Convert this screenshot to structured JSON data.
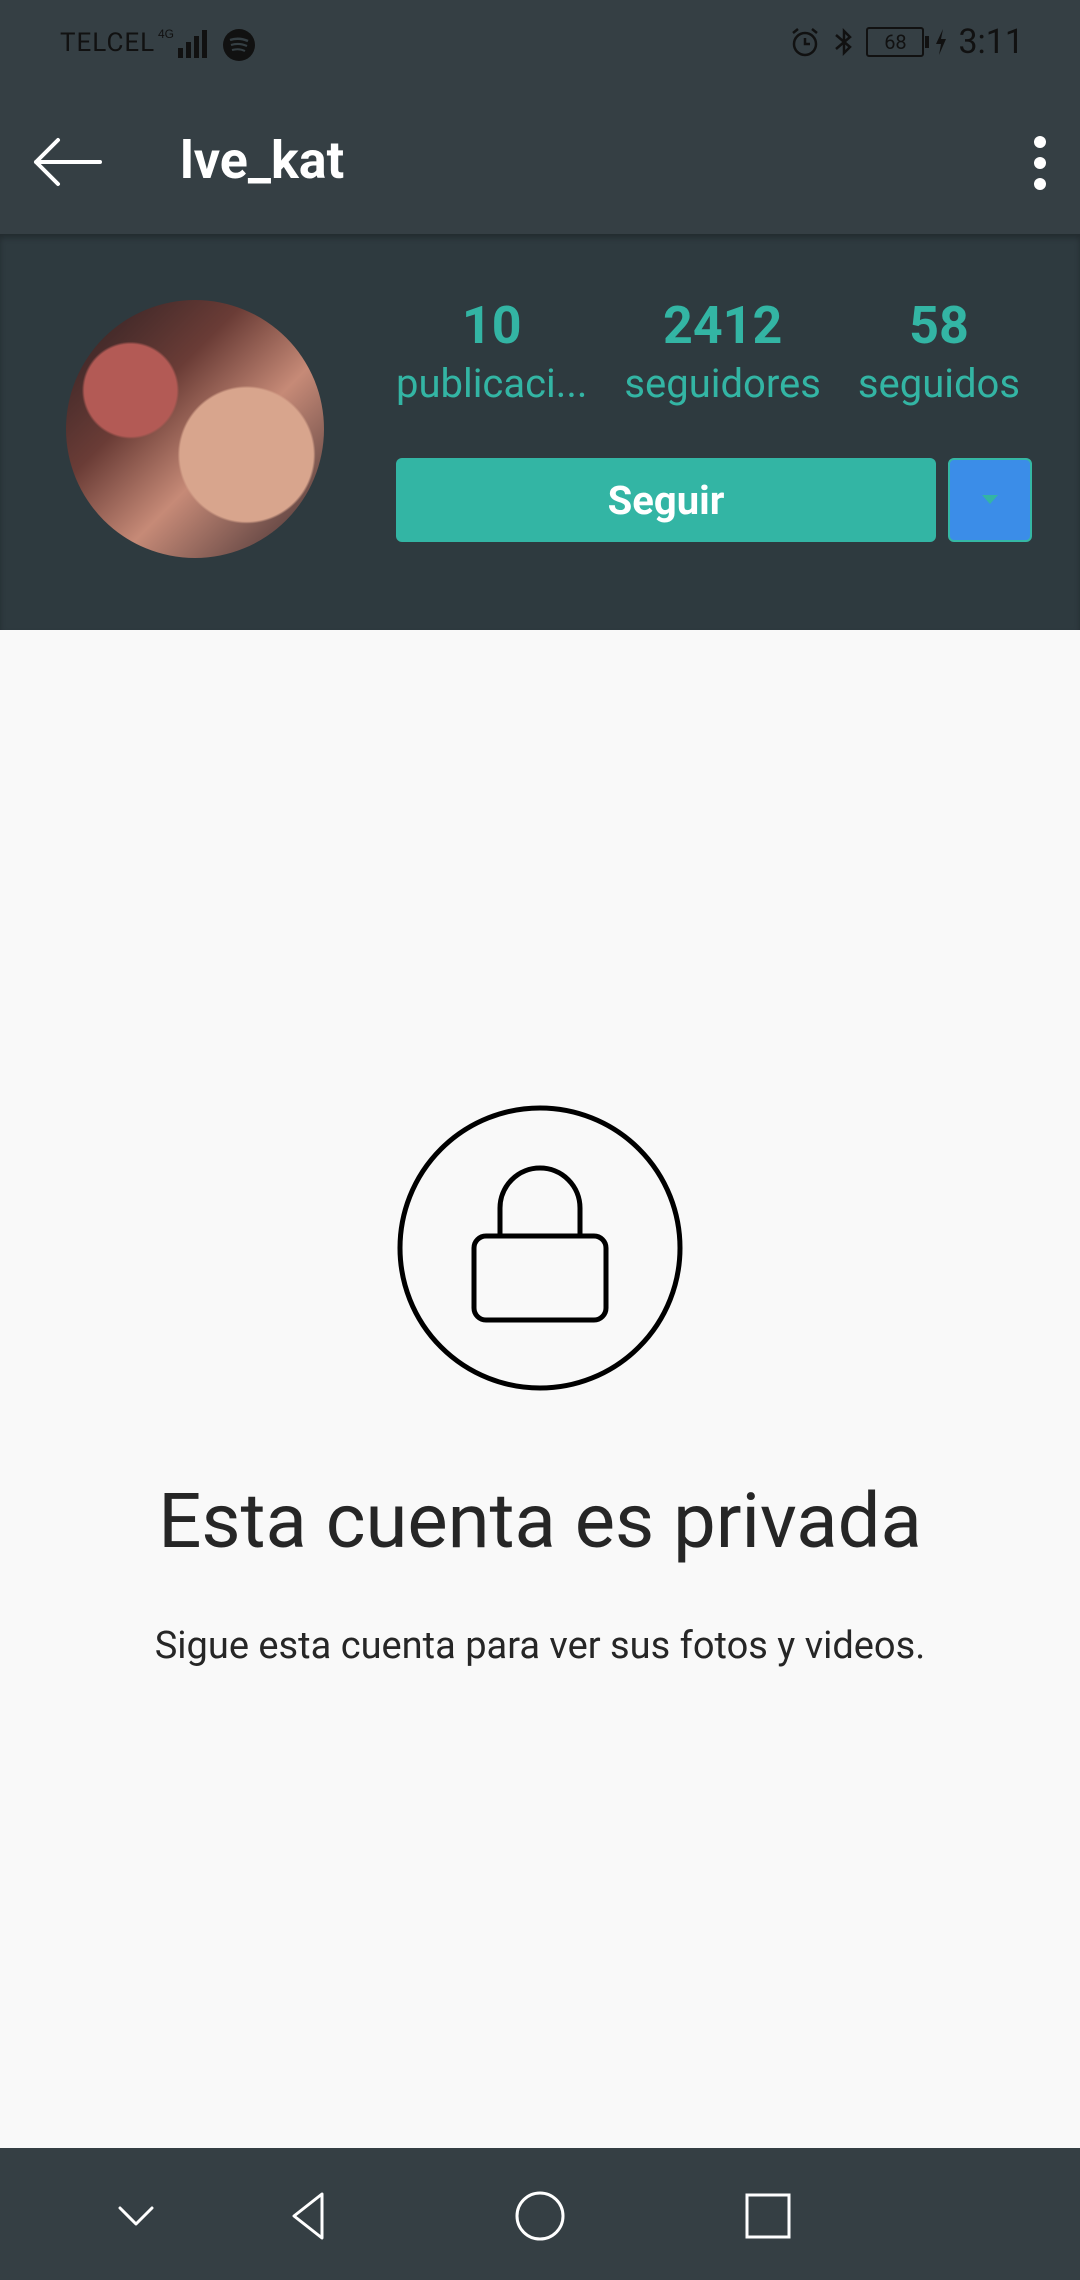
{
  "status_bar": {
    "carrier": "TELCEL",
    "battery": "68",
    "time": "3:11"
  },
  "app_bar": {
    "username": "lve_kat"
  },
  "profile": {
    "stats": [
      {
        "value": "10",
        "label": "publicaci..."
      },
      {
        "value": "2412",
        "label": "seguidores"
      },
      {
        "value": "58",
        "label": "seguidos"
      }
    ],
    "follow_label": "Seguir"
  },
  "private": {
    "title": "Esta cuenta es privada",
    "subtitle": "Sigue esta cuenta para ver sus fotos y videos."
  },
  "colors": {
    "header_bg": "#353f44",
    "accent": "#33b5a4",
    "dropdown": "#3b8de8"
  }
}
